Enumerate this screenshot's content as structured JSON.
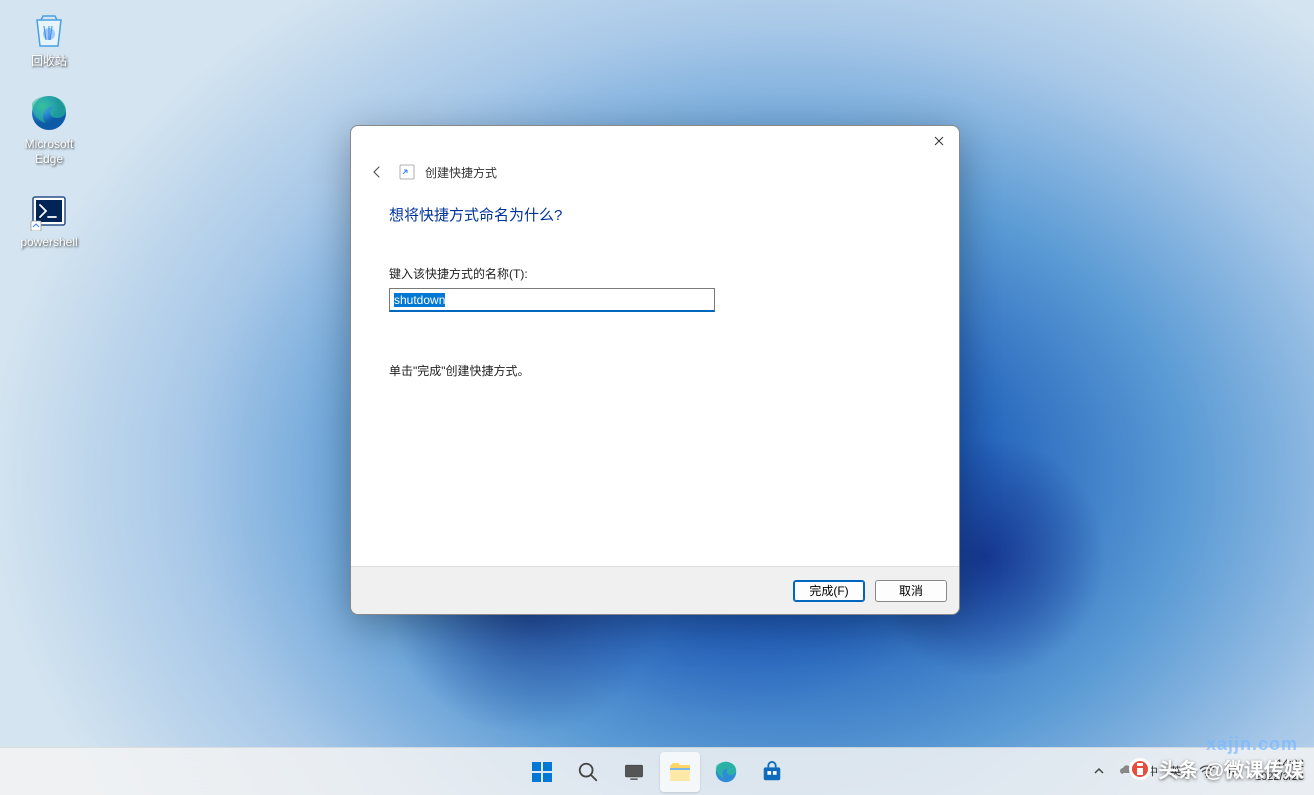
{
  "desktop": {
    "icons": [
      {
        "name": "recycle-bin",
        "label": "回收站"
      },
      {
        "name": "edge",
        "label": "Microsoft Edge"
      },
      {
        "name": "powershell",
        "label": "powershell"
      }
    ]
  },
  "dialog": {
    "wizard_title": "创建快捷方式",
    "heading": "想将快捷方式命名为什么?",
    "name_label": "键入该快捷方式的名称(T):",
    "name_value": "shutdown",
    "hint": "单击\"完成\"创建快捷方式。",
    "finish_label": "完成(F)",
    "cancel_label": "取消"
  },
  "taskbar": {
    "items": [
      {
        "name": "start",
        "icon": "windows-icon"
      },
      {
        "name": "search",
        "icon": "search-icon"
      },
      {
        "name": "task-view",
        "icon": "task-view-icon"
      },
      {
        "name": "file-explorer",
        "icon": "file-explorer-icon",
        "active": true
      },
      {
        "name": "edge",
        "icon": "edge-icon"
      },
      {
        "name": "store",
        "icon": "store-icon"
      }
    ]
  },
  "systray": {
    "chevron": "",
    "ime1": "中",
    "ime2": "英 ,",
    "time": "14:02",
    "date": "2022/3/23"
  },
  "watermark": {
    "prefix": "头条",
    "handle": "@微课传媒",
    "secondary": "xajjn.com"
  }
}
